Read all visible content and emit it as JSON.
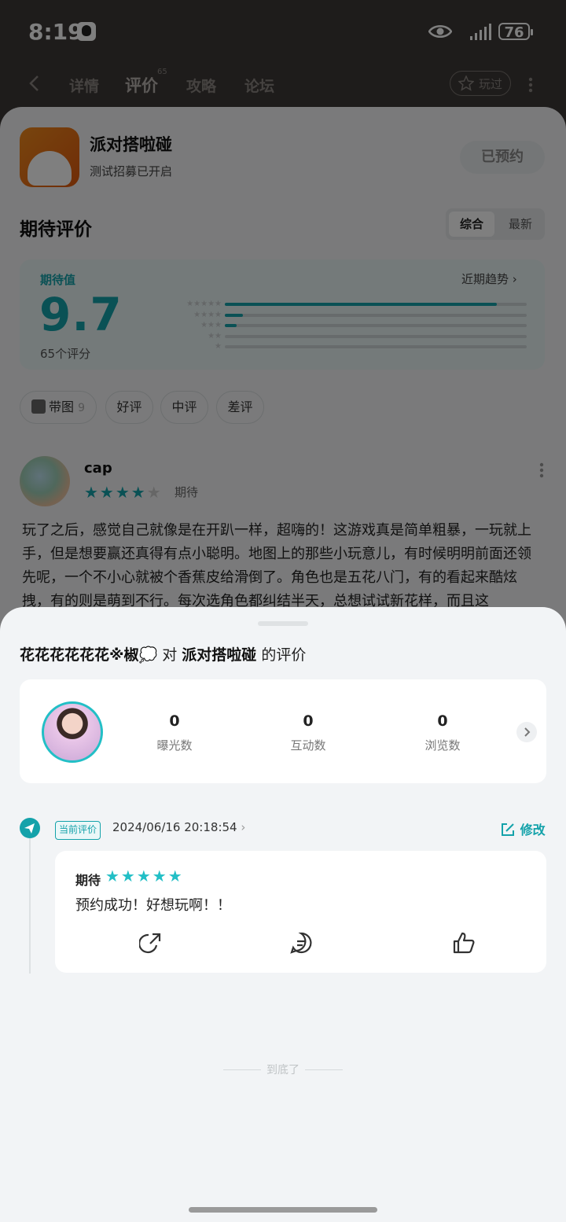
{
  "status": {
    "time": "8:19",
    "battery": "76"
  },
  "nav": {
    "tabs": [
      "详情",
      "评价",
      "攻略",
      "论坛"
    ],
    "review_count_sup": "65",
    "played_label": "玩过"
  },
  "app": {
    "name": "派对搭啦碰",
    "subtitle": "测试招募已开启",
    "reserve_button": "已预约"
  },
  "reviews": {
    "section_title": "期待评价",
    "sort_options": [
      "综合",
      "最新"
    ],
    "expect_label": "期待值",
    "trend_label": "近期趋势",
    "score": "9.7",
    "score_count": "65个评分",
    "distribution": [
      0.9,
      0.06,
      0.04,
      0.0,
      0.0
    ],
    "filters": {
      "with_image": "带图",
      "with_image_count": "9",
      "good": "好评",
      "medium": "中评",
      "bad": "差评"
    },
    "first_review": {
      "user": "cap",
      "rating": 4,
      "tag": "期待",
      "text": "玩了之后，感觉自己就像是在开趴一样，超嗨的！这游戏真是简单粗暴，一玩就上手，但是想要赢还真得有点小聪明。地图上的那些小玩意儿，有时候明明前面还领先呢，一个不小心就被个香蕉皮给滑倒了。角色也是五花八门，有的看起来酷炫拽，有的则是萌到不行。每次选角色都纠结半天，总想试试新花样，而且这"
    }
  },
  "sheet": {
    "user_name": "花花花花花花※椒💭",
    "title_mid": "对",
    "app_name": "派对搭啦碰",
    "title_end": "的评价",
    "stats": [
      {
        "value": "0",
        "label": "曝光数"
      },
      {
        "value": "0",
        "label": "互动数"
      },
      {
        "value": "0",
        "label": "浏览数"
      }
    ],
    "current_tag": "当前评价",
    "date": "2024/06/16 20:18:54",
    "edit_label": "修改",
    "my_review": {
      "tag": "期待",
      "rating": 5,
      "text": "预约成功！好想玩啊！！"
    },
    "end_label": "到底了"
  },
  "colors": {
    "accent": "#14a2aa",
    "accent_light": "#22bfc6"
  }
}
